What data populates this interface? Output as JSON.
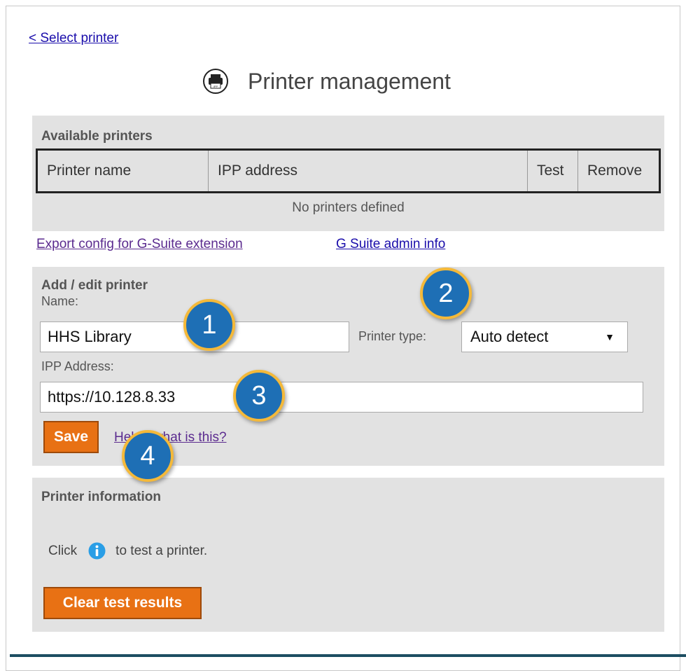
{
  "nav": {
    "back_label": "<  Select printer"
  },
  "header": {
    "title": "Printer management",
    "icon": "printer-icon"
  },
  "available": {
    "heading": "Available printers",
    "columns": [
      "Printer name",
      "IPP address",
      "Test",
      "Remove"
    ],
    "empty_message": "No printers defined"
  },
  "links": {
    "export": "Export config for G-Suite extension",
    "admin": "G Suite admin info"
  },
  "add_edit": {
    "heading": "Add / edit printer",
    "name_label": "Name:",
    "name_value": "HHS Library",
    "printer_type_label": "Printer type:",
    "printer_type_value": "Auto detect",
    "ipp_label": "IPP Address:",
    "ipp_value": "https://10.128.8.33",
    "save_label": "Save",
    "help_link": "Help - what is this?"
  },
  "info": {
    "heading": "Printer information",
    "hint_before": "Click",
    "hint_after": "to test a printer.",
    "clear_label": "Clear test results"
  },
  "callouts": [
    "1",
    "2",
    "3",
    "4"
  ],
  "colors": {
    "accent_button": "#e87114",
    "callout_fill": "#1e6fb5",
    "callout_border": "#f4b93a",
    "panel_bg": "#e2e2e2"
  }
}
